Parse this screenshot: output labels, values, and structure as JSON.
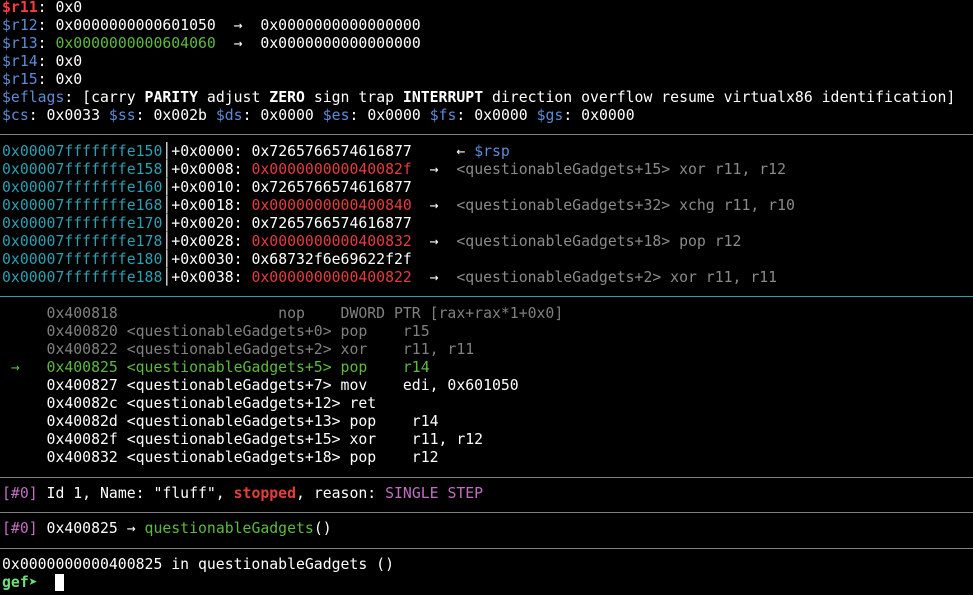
{
  "registers": [
    {
      "name": "$r11",
      "value": ": 0x0",
      "changed": true
    },
    {
      "name": "$r12",
      "value": ": 0x0000000000601050  →  0x0000000000000000"
    },
    {
      "name": "$r13",
      "value_prefix": ": ",
      "value_green": "0x0000000000604060",
      "value_suffix": "  →  0x0000000000000000"
    },
    {
      "name": "$r14",
      "value": ": 0x0"
    },
    {
      "name": "$r15",
      "value": ": 0x0"
    }
  ],
  "eflags": {
    "name": "$eflags",
    "parts": [
      ": [carry ",
      "PARITY",
      " adjust ",
      "ZERO",
      " sign trap ",
      "INTERRUPT",
      " direction overflow resume virtualx86 identification]"
    ]
  },
  "segments": [
    {
      "name": "$cs",
      "value": ": 0x0033 "
    },
    {
      "name": "$ss",
      "value": ": 0x002b "
    },
    {
      "name": "$ds",
      "value": ": 0x0000 "
    },
    {
      "name": "$es",
      "value": ": 0x0000 "
    },
    {
      "name": "$fs",
      "value": ": 0x0000 "
    },
    {
      "name": "$gs",
      "value": ": 0x0000"
    }
  ],
  "stack": [
    {
      "addr": "0x00007fffffffe150",
      "offset": "+0x0000: ",
      "value": "0x7265766574616877",
      "value_red": false,
      "arrow": "     ← ",
      "note": "$rsp",
      "note_type": "rsp"
    },
    {
      "addr": "0x00007fffffffe158",
      "offset": "+0x0008: ",
      "value": "0x000000000040082f",
      "value_red": true,
      "arrow": "  →  ",
      "note": "<questionableGadgets+15> xor r11, r12",
      "note_type": "grey"
    },
    {
      "addr": "0x00007fffffffe160",
      "offset": "+0x0010: ",
      "value": "0x7265766574616877",
      "value_red": false,
      "arrow": "",
      "note": "",
      "note_type": "grey"
    },
    {
      "addr": "0x00007fffffffe168",
      "offset": "+0x0018: ",
      "value": "0x0000000000400840",
      "value_red": true,
      "arrow": "  →  ",
      "note": "<questionableGadgets+32> xchg r11, r10",
      "note_type": "grey"
    },
    {
      "addr": "0x00007fffffffe170",
      "offset": "+0x0020: ",
      "value": "0x7265766574616877",
      "value_red": false,
      "arrow": "",
      "note": "",
      "note_type": "grey"
    },
    {
      "addr": "0x00007fffffffe178",
      "offset": "+0x0028: ",
      "value": "0x0000000000400832",
      "value_red": true,
      "arrow": "  →  ",
      "note": "<questionableGadgets+18> pop r12",
      "note_type": "grey"
    },
    {
      "addr": "0x00007fffffffe180",
      "offset": "+0x0030: ",
      "value": "0x68732f6e69622f2f",
      "value_red": false,
      "arrow": "",
      "note": "",
      "note_type": "grey"
    },
    {
      "addr": "0x00007fffffffe188",
      "offset": "+0x0038: ",
      "value": "0x0000000000400822",
      "value_red": true,
      "arrow": "  →  ",
      "note": "<questionableGadgets+2> xor r11, r11",
      "note_type": "grey"
    }
  ],
  "code": [
    {
      "marker": "   ",
      "text": "  0x400818                  nop    DWORD PTR [rax+rax*1+0x0]",
      "style": "grey"
    },
    {
      "marker": "   ",
      "text": "  0x400820 <questionableGadgets+0> pop    r15",
      "style": "grey"
    },
    {
      "marker": "   ",
      "text": "  0x400822 <questionableGadgets+2> xor    r11, r11",
      "style": "grey"
    },
    {
      "marker": " → ",
      "text": "  0x400825 <questionableGadgets+5> pop    r14",
      "style": "green"
    },
    {
      "marker": "   ",
      "text": "  0x400827 <questionableGadgets+7> mov    edi, 0x601050",
      "style": "white"
    },
    {
      "marker": "   ",
      "text": "  0x40082c <questionableGadgets+12> ret",
      "style": "white"
    },
    {
      "marker": "   ",
      "text": "  0x40082d <questionableGadgets+13> pop    r14",
      "style": "white"
    },
    {
      "marker": "   ",
      "text": "  0x40082f <questionableGadgets+15> xor    r11, r12",
      "style": "white"
    },
    {
      "marker": "   ",
      "text": "  0x400832 <questionableGadgets+18> pop    r12",
      "style": "white"
    }
  ],
  "threads": {
    "index": "[#0]",
    "text1": " Id 1, Name: \"fluff\", ",
    "state": "stopped",
    "text2": ", reason: ",
    "reason": "SINGLE STEP"
  },
  "trace": {
    "index": "[#0]",
    "addr": " 0x400825 → ",
    "func": "questionableGadgets",
    "suffix": "()"
  },
  "console": {
    "message": "0x0000000000400825 in questionableGadgets ()",
    "prompt": "gef➤",
    "input": "  "
  },
  "colors": {
    "background": "#000000",
    "register_changed": "#ff3b3b",
    "register_name": "#5c8cd6",
    "address": "#2aa1b3",
    "code_pointer": "#e53c3c",
    "current_instruction": "#5dbb3c",
    "thread_index": "#c070c0"
  }
}
